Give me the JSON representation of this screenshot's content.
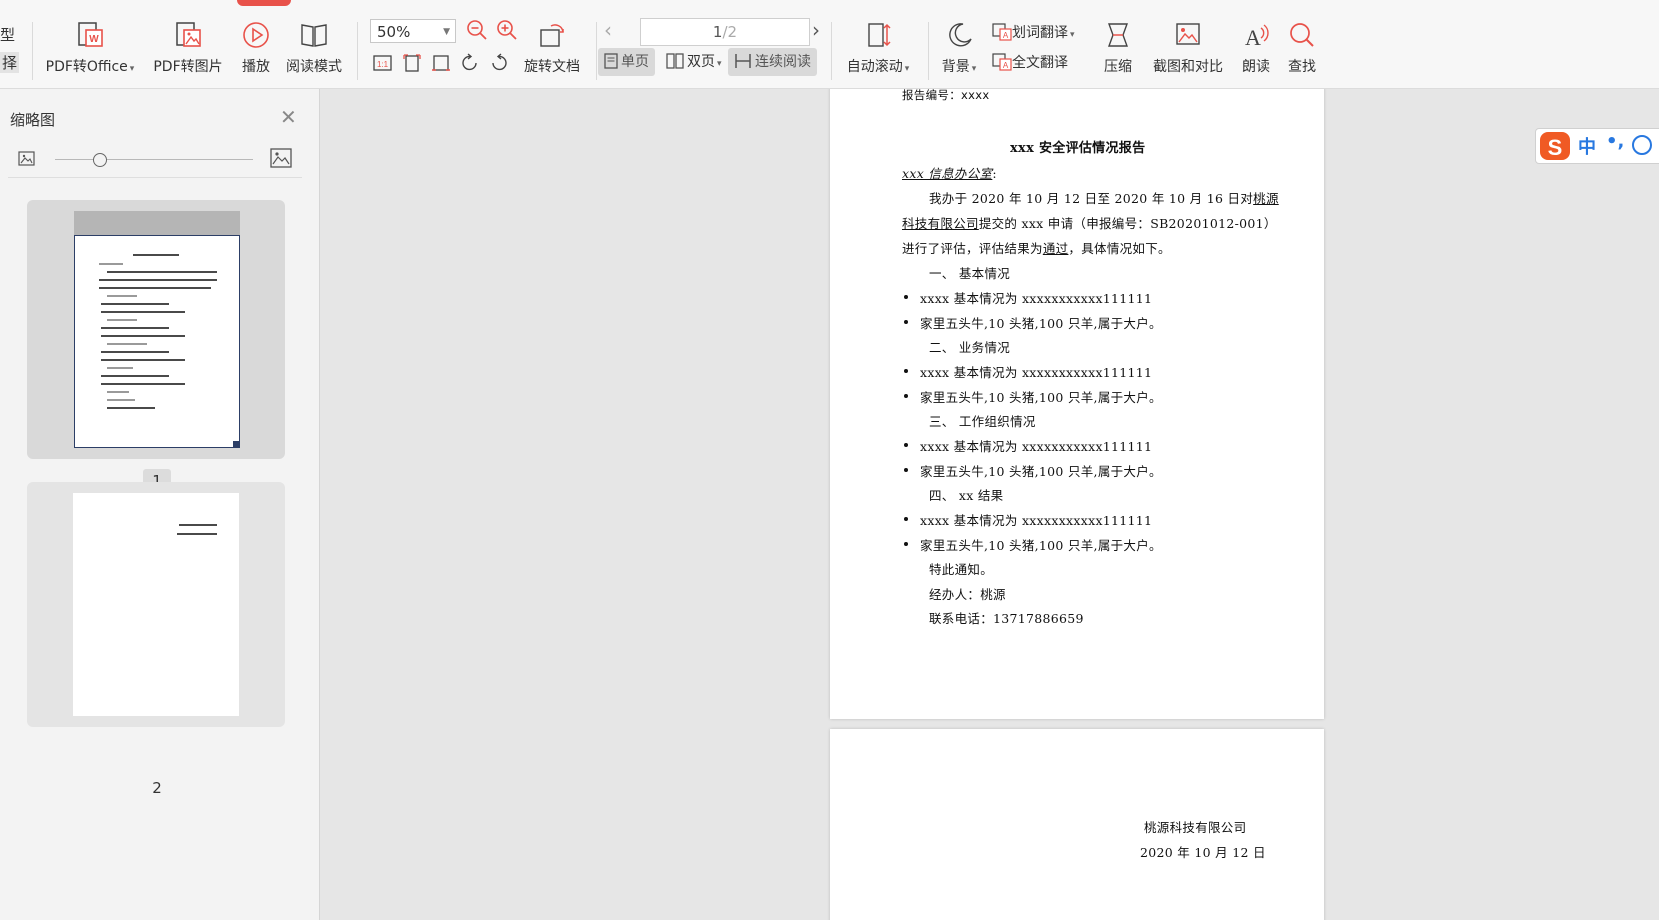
{
  "ribbon": {
    "left_cut_1": "型",
    "left_cut_2": "择",
    "pdf_to_office": "PDF转Office",
    "pdf_to_image": "PDF转图片",
    "play": "播放",
    "read_mode": "阅读模式",
    "zoom_value": "50%",
    "rotate_doc": "旋转文档",
    "page_current": "1",
    "page_total": "/2",
    "single_page": "单页",
    "double_page": "双页",
    "continuous": "连续阅读",
    "auto_scroll": "自动滚动",
    "background": "背景",
    "word_translate": "划词翻译",
    "full_translate": "全文翻译",
    "compress": "压缩",
    "screenshot_compare": "截图和对比",
    "read_aloud": "朗读",
    "find": "查找"
  },
  "sidebar": {
    "title": "缩略图",
    "thumbnails": [
      {
        "label": "1"
      },
      {
        "label": "2"
      }
    ]
  },
  "document": {
    "page1": {
      "report_no": "报告编号：xxxx",
      "title": "xxx 安全评估情况报告",
      "addressee": "xxx 信息办公室",
      "addressee_colon": ":",
      "para1_a": "我办于 2020 年 10 月 12 日至 2020 年 10 月 16 日对",
      "para1_company_a": "桃源",
      "para2_company_b": "科技有限公司",
      "para2_b": "提交的 xxx 申请（申报编号：SB20201012-001）",
      "para3_a": "进行了评估，评估结果为",
      "para3_pass": "通过",
      "para3_b": "，具体情况如下。",
      "sections": [
        {
          "heading": "一、 基本情况",
          "items": [
            "xxxx 基本情况为 xxxxxxxxxxx111111",
            "家里五头牛,10 头猪,100 只羊,属于大户。"
          ]
        },
        {
          "heading": "二、 业务情况",
          "items": [
            "xxxx 基本情况为 xxxxxxxxxxx111111",
            "家里五头牛,10 头猪,100 只羊,属于大户。"
          ]
        },
        {
          "heading": "三、 工作组织情况",
          "items": [
            "xxxx 基本情况为 xxxxxxxxxxx111111",
            "家里五头牛,10 头猪,100 只羊,属于大户。"
          ]
        },
        {
          "heading": "四、 xx 结果",
          "items": [
            "xxxx 基本情况为 xxxxxxxxxxx111111",
            "家里五头牛,10 头猪,100 只羊,属于大户。"
          ]
        }
      ],
      "notice": "特此通知。",
      "handler": "经办人：桃源",
      "phone": "联系电话：13717886659"
    },
    "page2": {
      "company": "桃源科技有限公司",
      "date": "2020 年 10 月 12 日"
    }
  },
  "ime": {
    "lang": "中",
    "punct": "•,"
  },
  "colors": {
    "accent_red": "#e8524a",
    "ime_blue": "#2878e0",
    "ime_orange": "#f05a24"
  }
}
